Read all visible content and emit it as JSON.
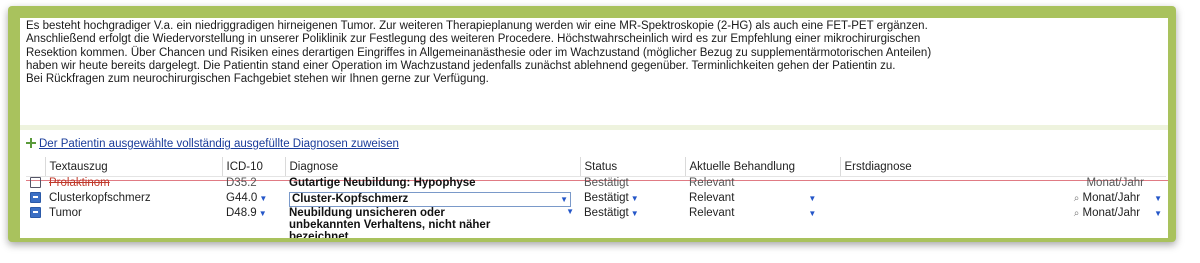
{
  "paragraph": [
    "Es besteht hochgradiger V.a. ein niedriggradigen hirneigenen Tumor. Zur weiteren Therapieplanung werden wir eine MR-Spektroskopie (2-HG) als auch eine FET-PET ergänzen.",
    "Anschließend erfolgt die Wiedervorstellung in unserer Poliklinik zur Festlegung des weiteren Procedere. Höchstwahrscheinlich wird es zur Empfehlung einer mikrochirurgischen",
    "Resektion kommen. Über Chancen und Risiken eines derartigen Eingriffes in Allgemeinanästhesie oder im Wachzustand (möglicher Bezug zu supplementärmotorischen Anteilen)",
    "haben wir heute bereits dargelegt. Die Patientin stand einer Operation im Wachzustand jedenfalls zunächst ablehnend gegenüber. Terminlichkeiten gehen der Patientin zu.",
    "Bei Rückfragen zum neurochirurgischen Fachgebiet stehen wir Ihnen gerne zur Verfügung."
  ],
  "assign_link": "Der Patientin ausgewählte vollständig ausgefüllte Diagnosen zuweisen",
  "table": {
    "headers": [
      "Textauszug",
      "ICD-10",
      "Diagnose",
      "Status",
      "Aktuelle Behandlung",
      "Erstdiagnose"
    ],
    "rows": [
      {
        "checked": false,
        "excerpt": "Prolaktinom",
        "icd": "D35.2",
        "diagnose": "Gutartige Neubildung: Hypophyse",
        "status": "Bestätigt",
        "behandlung": "Relevant",
        "erstdiagnose": "Monat/Jahr",
        "struck": true
      },
      {
        "checked": true,
        "excerpt": "Clusterkopfschmerz",
        "icd": "G44.0",
        "diagnose": "Cluster-Kopfschmerz",
        "status": "Bestätigt",
        "behandlung": "Relevant",
        "erstdiagnose": "Monat/Jahr",
        "struck": false
      },
      {
        "checked": true,
        "excerpt": "Tumor",
        "icd": "D48.9",
        "diagnose_lines": [
          "Neubildung unsicheren oder",
          "unbekannten Verhaltens, nicht näher",
          "bezeichnet"
        ],
        "status": "Bestätigt",
        "behandlung": "Relevant",
        "erstdiagnose": "Monat/Jahr",
        "struck": false
      }
    ]
  },
  "icons": {
    "add": "plus-icon",
    "dropdown": "chevron-down-icon",
    "search": "search-icon"
  },
  "colors": {
    "frame": "#a9c25d",
    "link": "#1a3c9a",
    "strike": "#e07b84",
    "checkbox": "#3b6fc4"
  }
}
